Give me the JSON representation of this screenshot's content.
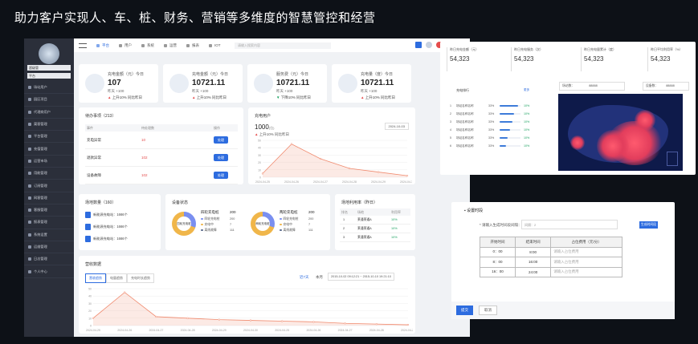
{
  "slide_title": "助力客户实现人、车、桩、财务、营销等多维度的智慧管控和经营",
  "sidebar": {
    "user_lines": [
      "超级管",
      "平台"
    ],
    "items": [
      "场站用户",
      "园区项目",
      "代理商用户",
      "渠客管理",
      "平台管理",
      "充值管理",
      "运营市场",
      "用能管理",
      "订阅管理",
      "网客管理",
      "客服管理",
      "报表管理",
      "系统设置",
      "运维管理",
      "日志管理",
      "个人中心"
    ]
  },
  "topbar": {
    "nav": [
      {
        "label": "平台",
        "active": true
      },
      {
        "label": "用户",
        "active": false
      },
      {
        "label": "系统",
        "active": false
      },
      {
        "label": "运营",
        "active": false
      },
      {
        "label": "报表",
        "active": false
      },
      {
        "label": "IOT",
        "active": false
      }
    ],
    "search_placeholder": "请输入搜索内容"
  },
  "stats": [
    {
      "label": "充电金额（元）今日",
      "value": "107",
      "sub": "昨天 +100",
      "change": "上升10%  同比昨日",
      "trend": "up"
    },
    {
      "label": "充电金额（元）今日",
      "value": "10721.11",
      "sub": "昨天 +100",
      "change": "上升10%  同比昨日",
      "trend": "up"
    },
    {
      "label": "服务费（元）今日",
      "value": "10721.11",
      "sub": "昨天 +100",
      "change": "下降10%  同比昨日",
      "trend": "down"
    },
    {
      "label": "充电量（度）今日",
      "value": "10721.11",
      "sub": "昨天 +100",
      "change": "上升10%  同比昨日",
      "trend": "up"
    }
  ],
  "todo": {
    "title": "待办事项（213）",
    "headers": [
      "事件",
      "待处理数",
      "操作"
    ],
    "rows": [
      {
        "event": "充电异常",
        "count": "10",
        "action": "处理"
      },
      {
        "event": "退款异常",
        "count": "102",
        "action": "处理"
      },
      {
        "event": "设备故障",
        "count": "102",
        "action": "处理"
      }
    ]
  },
  "charge_users": {
    "title": "充电用户",
    "value": "1000",
    "unit": "(位)",
    "change": "上升10%  同比昨日",
    "date": "2024-10-03",
    "chart_data": {
      "type": "area",
      "categories": [
        "2024-04-25",
        "2024-04-26",
        "2024-04-27",
        "2024-04-28",
        "2024-04-29",
        "2024-04-30"
      ],
      "values": [
        5,
        45,
        25,
        12,
        7,
        2
      ],
      "ylim": [
        0,
        50
      ],
      "yticks": [
        "50",
        "40",
        "30",
        "20",
        "10",
        "0"
      ],
      "color": "#f08a6e"
    }
  },
  "sites": {
    "title": "场地数量（160）",
    "items": [
      "新能源充电站：1666个",
      "新能源充电站：1666个",
      "新能源充电站：1666个"
    ]
  },
  "devices": {
    "title": "设备状态",
    "groups": [
      {
        "center": "四轮充电桩",
        "name": "四轮充电桩",
        "total": "200",
        "legend": [
          {
            "label": "四轮充电桩",
            "value": "200"
          },
          {
            "label": "充电中",
            "value": "7"
          },
          {
            "label": "离线故障",
            "value": "111"
          }
        ]
      },
      {
        "center": "两轮充电桩",
        "name": "两轮充电桩",
        "total": "200",
        "legend": [
          {
            "label": "四轮充电桩",
            "value": "200"
          },
          {
            "label": "充电中",
            "value": "7"
          },
          {
            "label": "离线故障",
            "value": "111"
          }
        ]
      }
    ]
  },
  "utilization": {
    "title": "场地利用率（昨日）",
    "headers": [
      "排名",
      "场地",
      "利用率"
    ],
    "rows": [
      {
        "rank": "1",
        "site": "莱通莱通A",
        "rate": "10%"
      },
      {
        "rank": "2",
        "site": "莱通莱通A",
        "rate": "10%"
      },
      {
        "rank": "3",
        "site": "莱通莱通A",
        "rate": "10%"
      }
    ]
  },
  "business": {
    "title": "营收数据",
    "tabs": [
      "营收趋势",
      "电量趋势",
      "充电时长趋势"
    ],
    "range_buttons": [
      "近7天",
      "本月"
    ],
    "date_range": "2015-10-02 09:12:21 ~ 2015-10-10 19:21:10",
    "chart_data": {
      "type": "area",
      "categories": [
        "2024-04-25",
        "2024-04-26",
        "2024-04-27",
        "2024-04-28",
        "2024-04-29",
        "2024-04-30",
        "2024-04-25",
        "2024-04-26",
        "2024-04-27",
        "2024-04-28",
        "2024-04-27"
      ],
      "values": [
        10,
        45,
        12,
        10,
        8,
        7,
        6,
        5,
        3,
        2,
        1
      ],
      "ylim": [
        0,
        50
      ],
      "yticks": [
        "50",
        "40",
        "30",
        "20",
        "10",
        "0"
      ],
      "color": "#f08a6e"
    }
  },
  "map_panel": {
    "kpis": [
      {
        "label": "昨日充电金额（元）",
        "value": "54,323"
      },
      {
        "label": "昨日充电服务（次）",
        "value": "54,323"
      },
      {
        "label": "昨日充电量累计（度）",
        "value": "54,323"
      },
      {
        "label": "昨日平均利用率（%）",
        "value": "54,323"
      }
    ],
    "rank_title": "充电排行",
    "rank_more": "更多",
    "rank_rows": [
      {
        "no": "1",
        "name": "场站名称名称",
        "pct": "33%",
        "fill": 0.9,
        "val": "10%"
      },
      {
        "no": "2",
        "name": "场站名称名称",
        "pct": "33%",
        "fill": 0.7,
        "val": "10%"
      },
      {
        "no": "3",
        "name": "场站名称名称",
        "pct": "33%",
        "fill": 0.6,
        "val": "10%"
      },
      {
        "no": "4",
        "name": "场站名称名称",
        "pct": "33%",
        "fill": 0.5,
        "val": "10%"
      },
      {
        "no": "5",
        "name": "场站名称名称",
        "pct": "33%",
        "fill": 0.4,
        "val": "10%"
      },
      {
        "no": "6",
        "name": "场站名称名称",
        "pct": "33%",
        "fill": 0.3,
        "val": "10%"
      }
    ],
    "map_chips": [
      {
        "label": "场站数：",
        "value": "88888"
      },
      {
        "label": "设备数：",
        "value": "88888"
      }
    ]
  },
  "settings_panel": {
    "title": "设置时段",
    "field_label": "* 请输入生成时间段间隔：",
    "field_placeholder": "间隔：2",
    "gen_button": "生成时间段",
    "headers": [
      "开始时间",
      "结束时间",
      "占位费用（元/分）"
    ],
    "rows": [
      {
        "start": "0：00",
        "end": "8:00",
        "fee_placeholder": "请输入占位费用"
      },
      {
        "start": "8：00",
        "end": "16:00",
        "fee_placeholder": "请输入占位费用"
      },
      {
        "start": "16：00",
        "end": "24:00",
        "fee_placeholder": "请输入占位费用"
      }
    ],
    "submit": "提交",
    "cancel": "取消"
  }
}
